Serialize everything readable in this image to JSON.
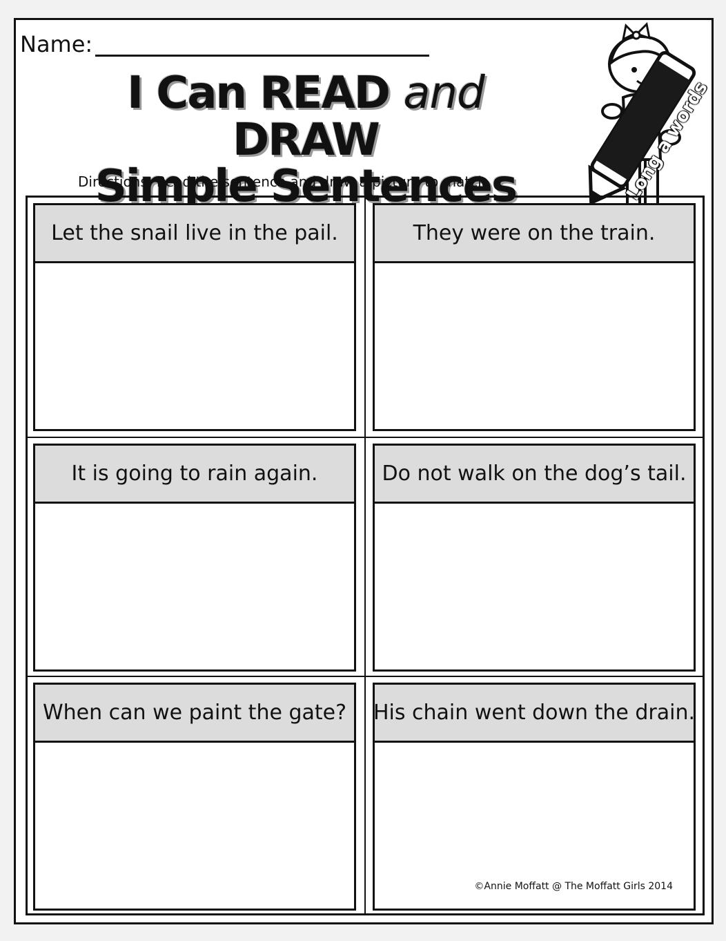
{
  "header": {
    "name_label": "Name:",
    "title_part1": "I Can READ ",
    "title_and": "and",
    "title_part2": " DRAW",
    "title_line2": "Simple Sentences",
    "directions": "Directions:  Read the sentence and draw a picture to match."
  },
  "mascot": {
    "crayon_label": "Long a words"
  },
  "cells": [
    {
      "sentence": "Let the snail live in the pail."
    },
    {
      "sentence": "They were on the train."
    },
    {
      "sentence": "It is going to rain again."
    },
    {
      "sentence": "Do not walk on the dog’s tail."
    },
    {
      "sentence": "When can we paint the gate?"
    },
    {
      "sentence": "His chain went down the drain."
    }
  ],
  "footer": {
    "credit": "©Annie Moffatt @ The Moffatt Girls 2014"
  }
}
